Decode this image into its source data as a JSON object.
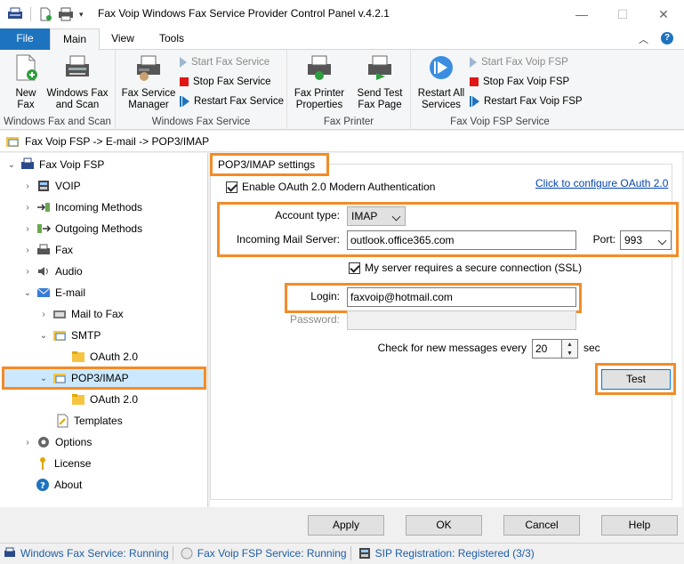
{
  "window": {
    "title": "Fax Voip Windows Fax Service Provider Control Panel v.4.2.1"
  },
  "ribbon_tabs": [
    {
      "label": "File"
    },
    {
      "label": "Main"
    },
    {
      "label": "View"
    },
    {
      "label": "Tools"
    }
  ],
  "ribbon": {
    "groups": [
      {
        "label": "Windows Fax and Scan",
        "buttons": [
          {
            "label_line1": "New",
            "label_line2": "Fax"
          },
          {
            "label_line1": "Windows Fax",
            "label_line2": "and Scan"
          }
        ]
      },
      {
        "label": "Windows Fax Service",
        "buttons": [
          {
            "label_line1": "Fax Service",
            "label_line2": "Manager"
          }
        ],
        "small_buttons": [
          {
            "label": "Start Fax Service",
            "enabled": false
          },
          {
            "label": "Stop Fax Service",
            "enabled": true
          },
          {
            "label": "Restart Fax Service",
            "enabled": true
          }
        ]
      },
      {
        "label": "Fax Printer",
        "buttons": [
          {
            "label_line1": "Fax Printer",
            "label_line2": "Properties"
          },
          {
            "label_line1": "Send Test",
            "label_line2": "Fax Page"
          }
        ]
      },
      {
        "label": "Fax Voip FSP Service",
        "buttons": [
          {
            "label_line1": "Restart All",
            "label_line2": "Services"
          }
        ],
        "small_buttons": [
          {
            "label": "Start Fax Voip FSP",
            "enabled": false
          },
          {
            "label": "Stop Fax Voip FSP",
            "enabled": true
          },
          {
            "label": "Restart Fax Voip FSP",
            "enabled": true
          }
        ]
      }
    ]
  },
  "breadcrumb": "Fax Voip FSP -> E-mail -> POP3/IMAP",
  "tree": {
    "root": "Fax Voip FSP",
    "items": [
      {
        "label": "VOIP"
      },
      {
        "label": "Incoming Methods"
      },
      {
        "label": "Outgoing Methods"
      },
      {
        "label": "Fax"
      },
      {
        "label": "Audio"
      },
      {
        "label": "E-mail"
      },
      {
        "label": "Mail to Fax"
      },
      {
        "label": "SMTP"
      },
      {
        "label": "OAuth 2.0"
      },
      {
        "label": "POP3/IMAP"
      },
      {
        "label": "OAuth 2.0"
      },
      {
        "label": "Templates"
      },
      {
        "label": "Options"
      },
      {
        "label": "License"
      },
      {
        "label": "About"
      }
    ]
  },
  "settings": {
    "title": "POP3/IMAP settings",
    "oauth_checkbox_label": "Enable OAuth 2.0 Modern Authentication",
    "oauth_link": "Click to configure OAuth 2.0",
    "account_type_label": "Account type:",
    "account_type_value": "IMAP",
    "server_label": "Incoming Mail Server:",
    "server_value": "outlook.office365.com",
    "port_label": "Port:",
    "port_value": "993",
    "ssl_checkbox_label": "My server requires a secure connection (SSL)",
    "login_label": "Login:",
    "login_value": "faxvoip@hotmail.com",
    "password_label": "Password:",
    "password_value": "",
    "check_label": "Check for new messages every",
    "check_value": "20",
    "check_unit": "sec",
    "test_button": "Test"
  },
  "dialog_buttons": {
    "apply": "Apply",
    "ok": "OK",
    "cancel": "Cancel",
    "help": "Help"
  },
  "status": {
    "fax_service": "Windows Fax Service: Running",
    "fsp_service": "Fax Voip FSP Service: Running",
    "sip": "SIP Registration: Registered (3/3)"
  },
  "colors": {
    "highlight": "#f28c28",
    "accent": "#1e73be",
    "selection": "#cce8ff",
    "link": "#0645ad"
  }
}
